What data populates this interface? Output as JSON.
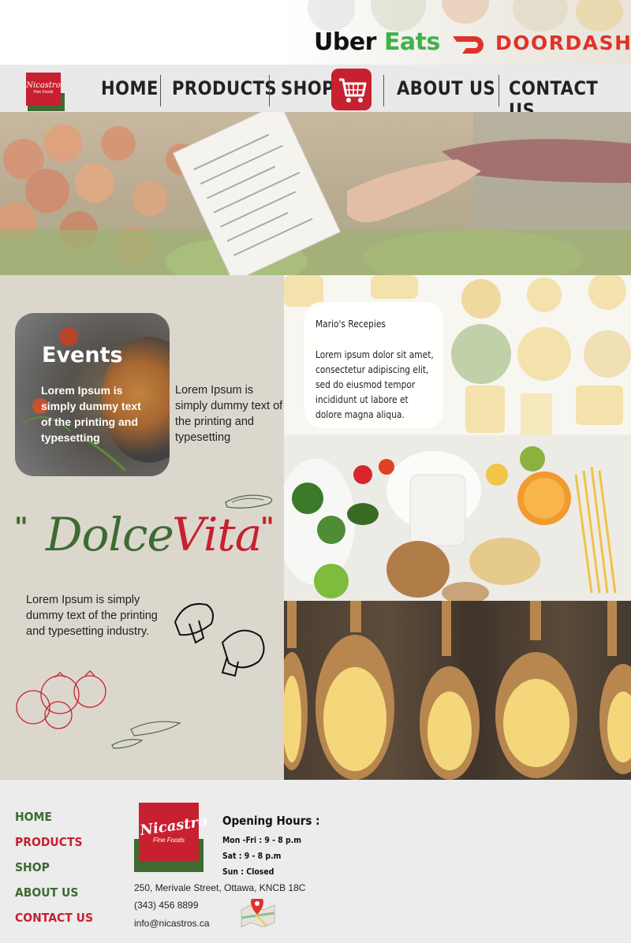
{
  "partners": {
    "uber_part1": "Uber",
    "uber_part2": "Eats",
    "doordash": "DOORDASH"
  },
  "brand": {
    "logo_name": "Nicastro",
    "logo_sub": "Fine Foods"
  },
  "nav": {
    "items": [
      {
        "label": "HOME"
      },
      {
        "label": "PRODUCTS"
      },
      {
        "label": "SHOP"
      },
      {
        "label": "ABOUT US"
      },
      {
        "label": "CONTACT US"
      }
    ]
  },
  "events": {
    "title": "Events",
    "text": "Lorem Ipsum is simply dummy text of the printing and typesetting",
    "side_text": "Lorem Ipsum is simply dummy text of the printing and typesetting"
  },
  "recipes": {
    "title": "Mario's Recepies",
    "text": "Lorem ipsum dolor sit amet, consectetur adipiscing elit, sed do eiusmod tempor incididunt ut labore et dolore magna aliqua."
  },
  "dolce_vita": {
    "open_quote": "\"",
    "word1": "Dolce",
    "word2": "Vita",
    "close_quote": "\"",
    "text": "Lorem Ipsum is simply dummy text of the printing and typesetting industry."
  },
  "footer": {
    "links": [
      {
        "label": "HOME"
      },
      {
        "label": "PRODUCTS"
      },
      {
        "label": "SHOP"
      },
      {
        "label": "ABOUT US"
      },
      {
        "label": "CONTACT US"
      }
    ],
    "hours_title": "Opening Hours :",
    "hours": [
      "Mon -Fri : 9 - 8 p.m",
      "Sat : 9 - 8 p.m",
      "Sun : Closed"
    ],
    "address": "250, Merivale Street, Ottawa, KNCB 18C",
    "phone": "(343) 456 8899",
    "email": "info@nicastros.ca"
  },
  "colors": {
    "brand_red": "#c8202f",
    "brand_green": "#3d6b32",
    "uber_green": "#3fb24a",
    "doordash_red": "#e0322a"
  },
  "icons": [
    "cart-icon",
    "doordash-icon",
    "map-location-icon",
    "mushroom-icon",
    "tomato-sketch-icon",
    "pepper-sketch-icon"
  ]
}
